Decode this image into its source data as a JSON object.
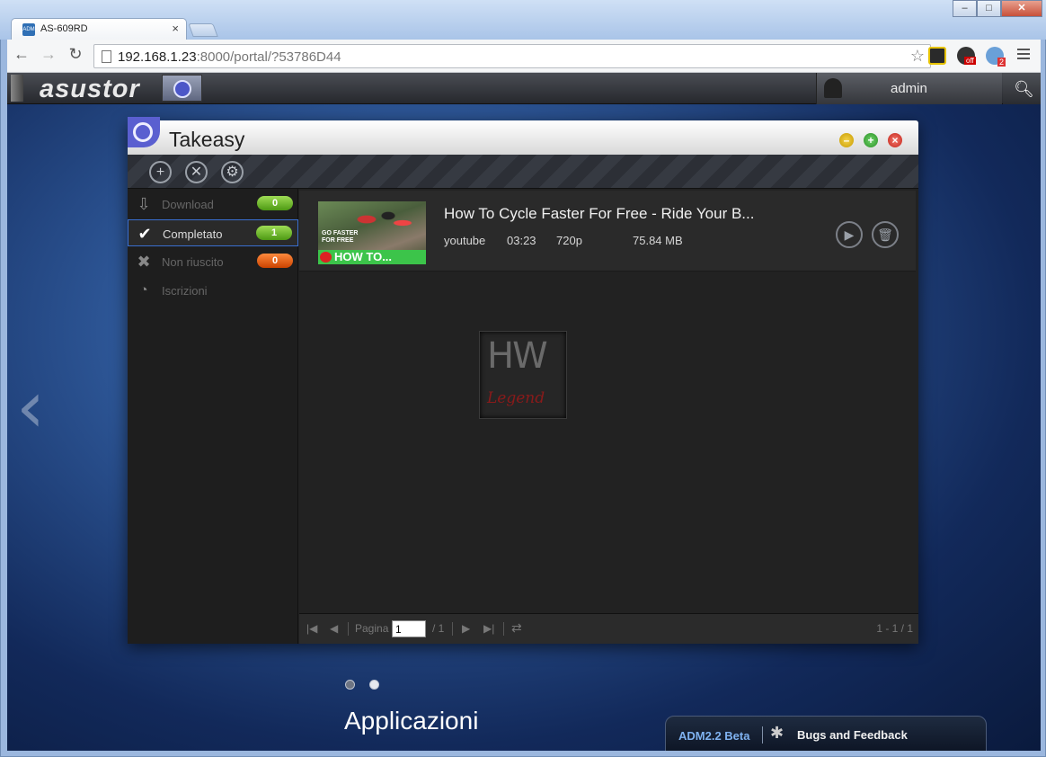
{
  "browser": {
    "tab_title": "AS-609RD",
    "tab_favicon": "ADM",
    "url_host": "192.168.1.23",
    "url_rest": ":8000/portal/?53786D44",
    "ext_badge_off": "off",
    "ext_badge_count": "2"
  },
  "adm": {
    "logo": "asustor",
    "user": "admin"
  },
  "window": {
    "title": "Takeasy",
    "sidebar": [
      {
        "label": "Download",
        "count": "0",
        "icon": "download-icon"
      },
      {
        "label": "Completato",
        "count": "1",
        "icon": "check-icon"
      },
      {
        "label": "Non riuscito",
        "count": "0",
        "icon": "x-icon"
      },
      {
        "label": "Iscrizioni",
        "count": "",
        "icon": "rss-icon"
      }
    ],
    "item": {
      "title": "How To Cycle Faster For Free - Ride Your B...",
      "source": "youtube",
      "duration": "03:23",
      "quality": "720p",
      "size": "75.84 MB",
      "thumb_tag": "GO FASTER FOR FREE",
      "thumb_bar": "HOW TO..."
    },
    "watermark": {
      "top": "HW",
      "bottom": "Legend"
    },
    "pager": {
      "label": "Pagina",
      "page": "1",
      "total": "/ 1",
      "range": "1 - 1 / 1"
    }
  },
  "desktop": {
    "section_title": "Applicazioni",
    "adm_version": "ADM2.2 Beta",
    "feedback": "Bugs and Feedback"
  }
}
